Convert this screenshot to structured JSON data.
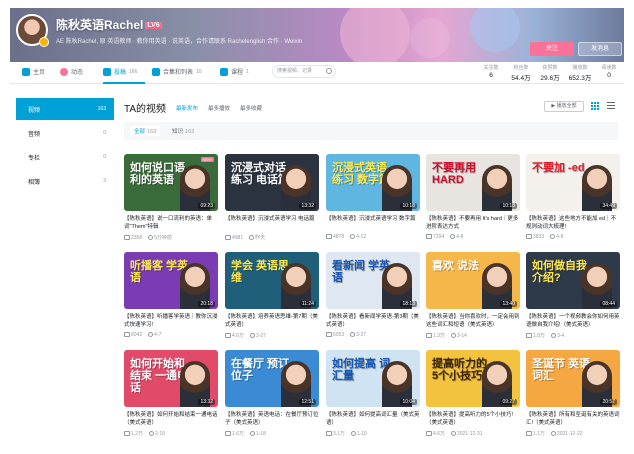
{
  "profile": {
    "name": "陈秋英语Rachel",
    "level": "LV6",
    "sign": "AE 陈秋Rachel, 原 英语教师 · 教你用英语 · 说英语，合作请联系 Rachelenglish 合作 · Weixin"
  },
  "actions": {
    "follow": "关注",
    "message": "发消息"
  },
  "nav": [
    {
      "label": "主页",
      "count": "",
      "icon": "home-icon",
      "color": "#00a1d6"
    },
    {
      "label": "动态",
      "count": "",
      "icon": "dynamic-icon",
      "color": "#fb7299"
    },
    {
      "label": "投稿",
      "count": "166",
      "icon": "video-icon",
      "color": "#00a1d6"
    },
    {
      "label": "合集和列表",
      "count": "10",
      "icon": "collection-icon",
      "color": "#00a1d6"
    },
    {
      "label": "课程",
      "count": "1",
      "icon": "course-icon",
      "color": "#00a1d6"
    }
  ],
  "search": {
    "placeholder": "搜索视频、记录"
  },
  "stats": [
    {
      "label": "关注数",
      "value": "6"
    },
    {
      "label": "粉丝数",
      "value": "54.4万"
    },
    {
      "label": "获赞数",
      "value": "29.6万"
    },
    {
      "label": "播放数",
      "value": "652.3万"
    },
    {
      "label": "阅读数",
      "value": "0"
    }
  ],
  "sidebar": [
    {
      "label": "视频",
      "count": "163"
    },
    {
      "label": "音频",
      "count": "0"
    },
    {
      "label": "专栏",
      "count": "0"
    },
    {
      "label": "相簿",
      "count": "3"
    }
  ],
  "main": {
    "title": "TA的视频",
    "sort_tabs": [
      "最新发布",
      "最多播放",
      "最多收藏"
    ],
    "play_all": "▶ 播放全部"
  },
  "filters": [
    {
      "label": "全部",
      "count": "163"
    },
    {
      "label": "知识",
      "count": "163"
    }
  ],
  "videos": [
    {
      "thumb_text": "如何说口语利的英语",
      "bg": "#3a6b3a",
      "fg": "#ffffff",
      "duration": "09:23",
      "is_new": true,
      "title": "【陈秋英语】说一口流利的英语：单词\"Them\"特辑",
      "plays": "2358",
      "date": "5分钟前"
    },
    {
      "thumb_text": "沉浸式对话练习 电话篇",
      "bg": "#2c3340",
      "fg": "#ffffff",
      "duration": "13:32",
      "is_new": false,
      "title": "【陈秋英语】沉浸式英语学习 电话篇",
      "plays": "4981",
      "date": "昨天"
    },
    {
      "thumb_text": "沉浸式英语练习 数字篇",
      "bg": "#5fb6e0",
      "fg": "#ffe94d",
      "duration": "10:18",
      "is_new": false,
      "title": "【陈秋英语】沉浸式英语学习 数字篇",
      "plays": "4878",
      "date": "4-12"
    },
    {
      "thumb_text": "不要再用 HARD",
      "bg": "#e8e4df",
      "fg": "#c8102e",
      "duration": "10:18",
      "is_new": false,
      "title": "【陈秋英语】不要再用 It's hard｜更多进阶表达方式",
      "plays": "7204",
      "date": "4-8"
    },
    {
      "thumb_text": "不要加 -ed",
      "bg": "#f4f1ec",
      "fg": "#e01b2b",
      "duration": "34:49",
      "is_new": false,
      "title": "【陈秋英语】这些地方不能加 ed｜不规则动词大梳理!",
      "plays": "3833",
      "date": "4-8"
    },
    {
      "thumb_text": "听播客 学英语",
      "bg": "#7a3bb3",
      "fg": "#ffe94d",
      "duration": "20:18",
      "is_new": false,
      "title": "【陈秋英语】听播客学英语｜教你沉浸式快速学习!",
      "plays": "8042",
      "date": "4-7"
    },
    {
      "thumb_text": "学会 英语思维",
      "bg": "#1f5f7a",
      "fg": "#ffe94d",
      "duration": "11:24",
      "is_new": false,
      "title": "【陈秋英语】培养英语思维-第7期（美式英语）",
      "plays": "4.6万",
      "date": "3-27"
    },
    {
      "thumb_text": "看新闻 学英语",
      "bg": "#dfe8f2",
      "fg": "#1a56b0",
      "duration": "18:13",
      "is_new": false,
      "title": "【陈秋英语】看新闻学英语-第3期（美式英语）",
      "plays": "6053",
      "date": "3-27"
    },
    {
      "thumb_text": "喜欢 说法",
      "bg": "#f6b74a",
      "fg": "#ffffff",
      "duration": "13:40",
      "is_new": false,
      "title": "【陈秋英语】当你喜欢时，一定会用到这些词汇和短语（美式英语）",
      "plays": "1.3万",
      "date": "3-14"
    },
    {
      "thumb_text": "如何做自我介绍?",
      "bg": "#2e3a4a",
      "fg": "#ffe94d",
      "duration": "08:44",
      "is_new": false,
      "title": "【陈秋英语】一个视频教会你如何用英语做自我介绍!（美式英语）",
      "plays": "1.8万",
      "date": "3-4"
    },
    {
      "thumb_text": "如何开始和结束 一通电话",
      "bg": "#e24a6a",
      "fg": "#ffffff",
      "duration": "13:32",
      "is_new": false,
      "title": "【陈秋英语】如何开始和结束一通电话（美式英语）",
      "plays": "1.2万",
      "date": "2-18"
    },
    {
      "thumb_text": "在餐厅 预订位子",
      "bg": "#3b8bd4",
      "fg": "#ffffff",
      "duration": "12:51",
      "is_new": false,
      "title": "【陈秋英语】英语电话：在餐厅预订位子（美式英语）",
      "plays": "1.6万",
      "date": "1-18"
    },
    {
      "thumb_text": "如何提高 词汇量",
      "bg": "#cfe3f2",
      "fg": "#1a56b0",
      "duration": "10:04",
      "is_new": false,
      "title": "【陈秋英语】如何提高词汇量（美式英语）",
      "plays": "3.1万",
      "date": "1-10"
    },
    {
      "thumb_text": "提高听力的 5个小技巧",
      "bg": "#f3c340",
      "fg": "#3a2200",
      "duration": "09:27",
      "is_new": false,
      "title": "【陈秋英语】提高听力的5个小技巧!（美式英语）",
      "plays": "4.6万",
      "date": "2021-12-31"
    },
    {
      "thumb_text": "圣诞节 英语词汇",
      "bg": "#f5a742",
      "fg": "#ffffff",
      "duration": "20:57",
      "is_new": false,
      "title": "【陈秋英语】所有和圣诞有关的英语词汇!（美式英语）",
      "plays": "1.1万",
      "date": "2021-12-22"
    }
  ]
}
